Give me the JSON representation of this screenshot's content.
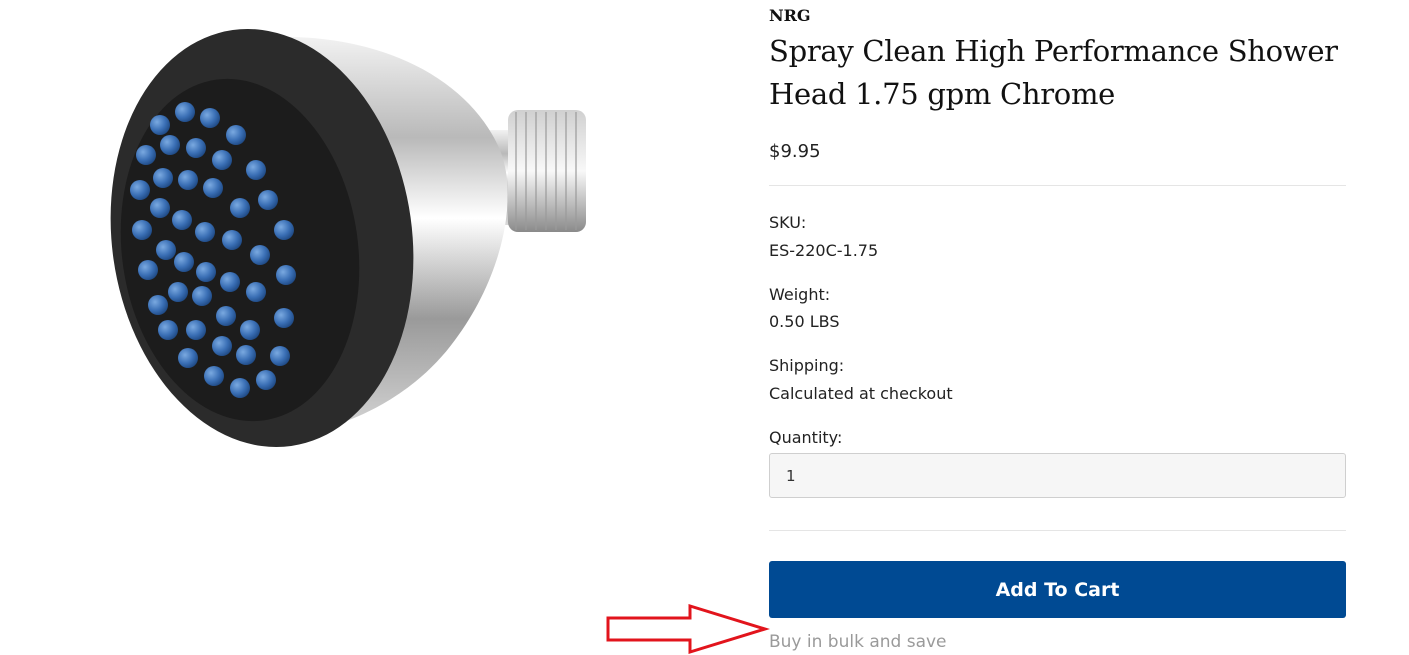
{
  "product": {
    "brand": "NRG",
    "title": "Spray Clean High Performance Shower Head 1.75 gpm Chrome",
    "price": "$9.95",
    "sku_label": "SKU:",
    "sku_value": "ES-220C-1.75",
    "weight_label": "Weight:",
    "weight_value": "0.50 LBS",
    "shipping_label": "Shipping:",
    "shipping_value": "Calculated at checkout",
    "quantity_label": "Quantity:",
    "quantity_value": "1",
    "add_to_cart_label": "Add To Cart",
    "bulk_link": "Buy in bulk and save"
  },
  "colors": {
    "button": "#004a93",
    "annotation_arrow": "#e2141c"
  }
}
